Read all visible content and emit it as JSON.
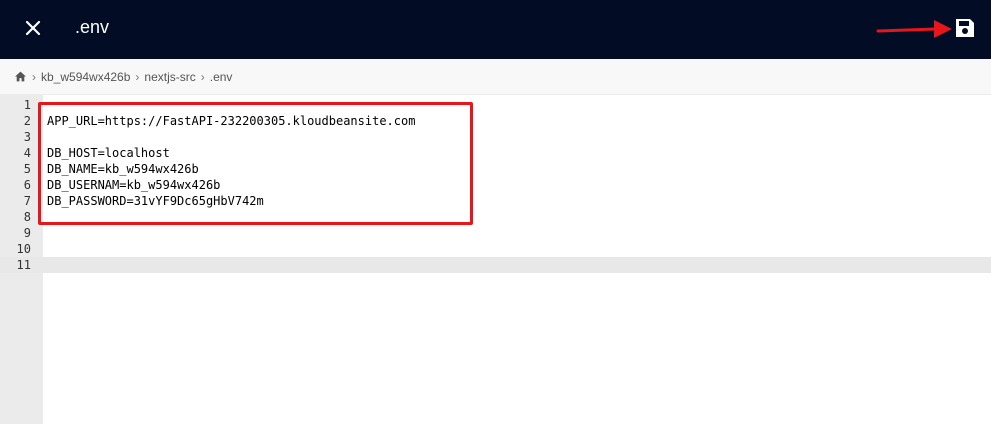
{
  "header": {
    "title": ".env",
    "close_icon": "close-icon",
    "save_icon": "floppy-disk-icon",
    "accent_color": "#e8151b",
    "background": "#020d25"
  },
  "breadcrumb": {
    "home_icon": "home-icon",
    "items": [
      "kb_w594wx426b",
      "nextjs-src",
      ".env"
    ]
  },
  "editor": {
    "active_line": 11,
    "lines": [
      {
        "num": "1",
        "text": ""
      },
      {
        "num": "2",
        "text": "APP_URL=https://FastAPI-232200305.kloudbeansite.com"
      },
      {
        "num": "3",
        "text": ""
      },
      {
        "num": "4",
        "text": "DB_HOST=localhost"
      },
      {
        "num": "5",
        "text": "DB_NAME=kb_w594wx426b"
      },
      {
        "num": "6",
        "text": "DB_USERNAM=kb_w594wx426b"
      },
      {
        "num": "7",
        "text": "DB_PASSWORD=31vYF9Dc65gHbV742m"
      },
      {
        "num": "8",
        "text": ""
      },
      {
        "num": "9",
        "text": ""
      },
      {
        "num": "10",
        "text": ""
      },
      {
        "num": "11",
        "text": ""
      }
    ]
  }
}
